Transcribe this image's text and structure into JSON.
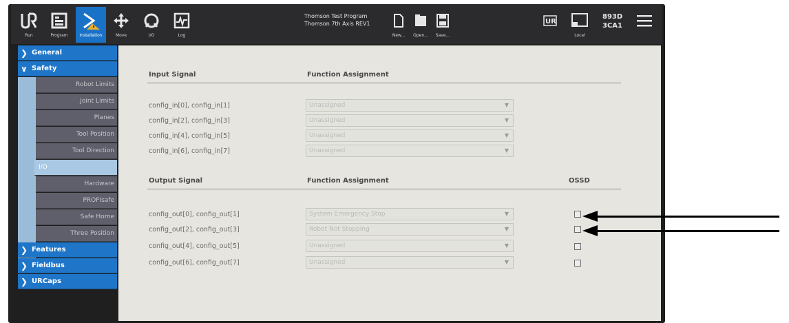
{
  "topbar": {
    "buttons": [
      {
        "label": "Run",
        "icon": "ur-logo-icon"
      },
      {
        "label": "Program",
        "icon": "program-icon"
      },
      {
        "label": "Installation",
        "icon": "installation-icon"
      },
      {
        "label": "Move",
        "icon": "move-icon"
      },
      {
        "label": "I/O",
        "icon": "io-icon"
      },
      {
        "label": "Log",
        "icon": "log-icon"
      }
    ],
    "program_title_1": "Thomson Test Program",
    "program_title_2": "Thomson 7th Axis REV1",
    "file_buttons": [
      {
        "label": "New...",
        "icon": "new-file-icon"
      },
      {
        "label": "Open...",
        "icon": "open-folder-icon"
      },
      {
        "label": "Save...",
        "icon": "save-icon"
      }
    ],
    "mode_label": "Local",
    "serial_line_1": "893D",
    "serial_line_2": "3CA1"
  },
  "sidebar": {
    "groups": [
      {
        "label": "General",
        "expanded": false
      },
      {
        "label": "Safety",
        "expanded": true
      },
      {
        "label": "Features",
        "expanded": false
      },
      {
        "label": "Fieldbus",
        "expanded": false
      },
      {
        "label": "URCaps",
        "expanded": false
      }
    ],
    "safety_items": [
      "Robot Limits",
      "Joint Limits",
      "Planes",
      "Tool Position",
      "Tool Direction",
      "I/O",
      "Hardware",
      "PROFIsafe",
      "Safe Home",
      "Three Position"
    ],
    "selected_item": "I/O"
  },
  "main": {
    "input_header": "Input Signal",
    "function_header": "Function Assignment",
    "inputs": [
      {
        "signal": "config_in[0], config_in[1]",
        "assignment": "Unassigned"
      },
      {
        "signal": "config_in[2], config_in[3]",
        "assignment": "Unassigned"
      },
      {
        "signal": "config_in[4], config_in[5]",
        "assignment": "Unassigned"
      },
      {
        "signal": "config_in[6], config_in[7]",
        "assignment": "Unassigned"
      }
    ],
    "output_header": "Output Signal",
    "function_header_2": "Function Assignment",
    "osso_header": "OSSD",
    "outputs": [
      {
        "signal": "config_out[0], config_out[1]",
        "assignment": "System Emergency Stop",
        "ossd": false
      },
      {
        "signal": "config_out[2], config_out[3]",
        "assignment": "Robot Not Stopping",
        "ossd": false
      },
      {
        "signal": "config_out[4], config_out[5]",
        "assignment": "Unassigned",
        "ossd": false
      },
      {
        "signal": "config_out[6], config_out[7]",
        "assignment": "Unassigned",
        "ossd": false
      }
    ]
  },
  "colors": {
    "accent_blue": "#1f76c9",
    "sidebar_sub": "#5f5f6b",
    "panel_bg": "#e6e5df",
    "topbar_bg": "#2b2b2d"
  }
}
